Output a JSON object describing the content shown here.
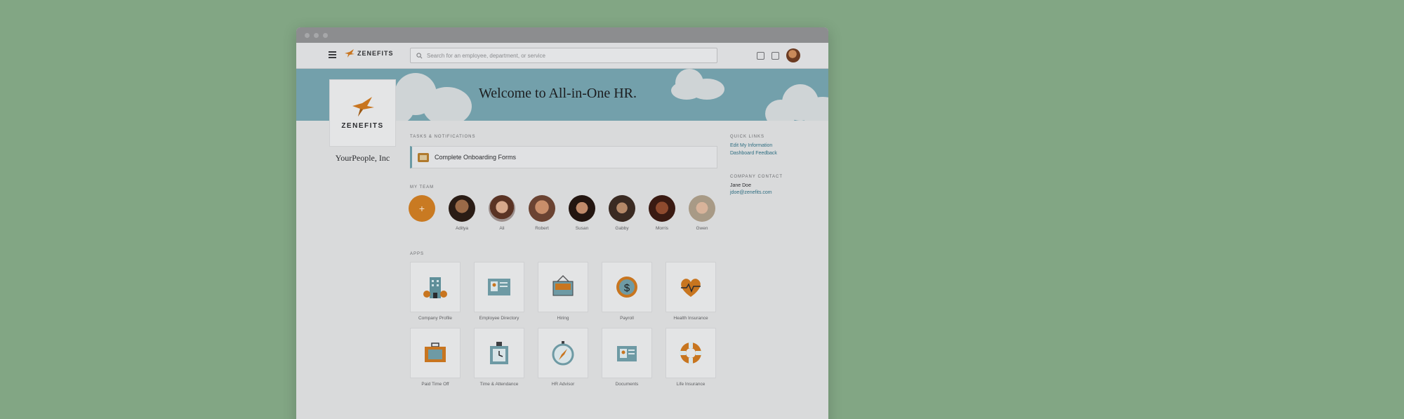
{
  "header": {
    "brand": "ZENEFITS",
    "search_placeholder": "Search for an employee, department, or service"
  },
  "banner": {
    "title": "Welcome to All-in-One HR."
  },
  "company": {
    "logo_text": "ZENEFITS",
    "name": "YourPeople, Inc"
  },
  "tasks": {
    "label": "TASKS & NOTIFICATIONS",
    "items": [
      {
        "label": "Complete Onboarding Forms"
      }
    ]
  },
  "team": {
    "label": "MY TEAM",
    "add_symbol": "+",
    "members": [
      {
        "name": "Aditya"
      },
      {
        "name": "Ali"
      },
      {
        "name": "Robert"
      },
      {
        "name": "Susan"
      },
      {
        "name": "Gabby"
      },
      {
        "name": "Morris"
      },
      {
        "name": "Gwen"
      }
    ]
  },
  "apps": {
    "label": "APPS",
    "items": [
      {
        "name": "Company Profile",
        "icon": "building-icon"
      },
      {
        "name": "Employee Directory",
        "icon": "directory-icon"
      },
      {
        "name": "Hiring",
        "icon": "help-wanted-icon"
      },
      {
        "name": "Payroll",
        "icon": "dollar-icon"
      },
      {
        "name": "Health Insurance",
        "icon": "heart-icon"
      },
      {
        "name": "Paid Time Off",
        "icon": "suitcase-icon"
      },
      {
        "name": "Time & Attendance",
        "icon": "clock-icon"
      },
      {
        "name": "HR Advisor",
        "icon": "compass-icon"
      },
      {
        "name": "Documents",
        "icon": "folder-icon"
      },
      {
        "name": "Life Insurance",
        "icon": "lifebuoy-icon"
      }
    ]
  },
  "quick_links": {
    "label": "QUICK LINKS",
    "links": [
      "Edit My Information",
      "Dashboard Feedback"
    ]
  },
  "company_contact": {
    "label": "COMPANY CONTACT",
    "name": "Jane Doe",
    "email": "jdoe@zenefits.com"
  }
}
